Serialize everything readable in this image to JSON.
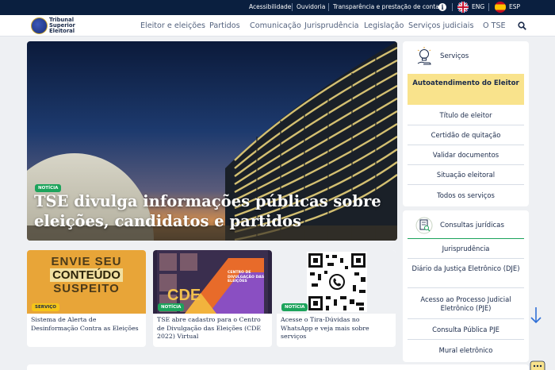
{
  "topbar": {
    "links": [
      "Acessibilidade",
      "Ouvidoria",
      "Transparência e prestação de contas"
    ],
    "lang_eng": "ENG",
    "lang_esp": "ESP"
  },
  "header": {
    "logo_line1": "Tribunal",
    "logo_line2": "Superior",
    "logo_line3": "Eleitoral",
    "nav": [
      "Eleitor e eleições",
      "Partidos",
      "Comunicação",
      "Jurisprudência",
      "Legislação",
      "Serviços judiciais",
      "O TSE"
    ]
  },
  "hero": {
    "badge": "NOTÍCIA",
    "title": "TSE divulga informações públicas sobre eleições, candidatos e partidos"
  },
  "cards": [
    {
      "badge": "SERVIÇO",
      "text": "Sistema de Alerta de Desinformação Contra as Eleições",
      "banner_line1": "ENVIE SEU",
      "banner_line2": "CONTEÚDO",
      "banner_line3": "SUSPEITO"
    },
    {
      "badge": "NOTÍCIA",
      "text": "TSE abre cadastro para o Centro de Divulgação das Eleições (CDE 2022) Virtual",
      "banner_big": "CDE",
      "banner_small": "CENTRO DE DIVULGAÇÃO DAS ELEIÇÕES"
    },
    {
      "badge": "NOTÍCIA",
      "text": "Acesse o Tira-Dúvidas no WhatsApp e veja mais sobre serviços"
    }
  ],
  "servicos": {
    "title": "Serviços",
    "highlight": "Autoatendimento do Eleitor",
    "items": [
      "Título de eleitor",
      "Certidão de quitação",
      "Validar documentos",
      "Situação eleitoral",
      "Todos os serviços"
    ]
  },
  "consultas": {
    "title": "Consultas jurídicas",
    "items": [
      "Jurisprudência",
      "Diário da Justiça Eletrônico (DJE)",
      "Acesso ao Processo Judicial Eletrônico (PJE)",
      "Consulta Pública PJE",
      "Mural eletrônico"
    ]
  },
  "colors": {
    "topbar": "#0a1f3f",
    "accent_yellow": "#f9e38c",
    "badge_green": "#1ca35b",
    "badge_yellow": "#f5c518"
  }
}
